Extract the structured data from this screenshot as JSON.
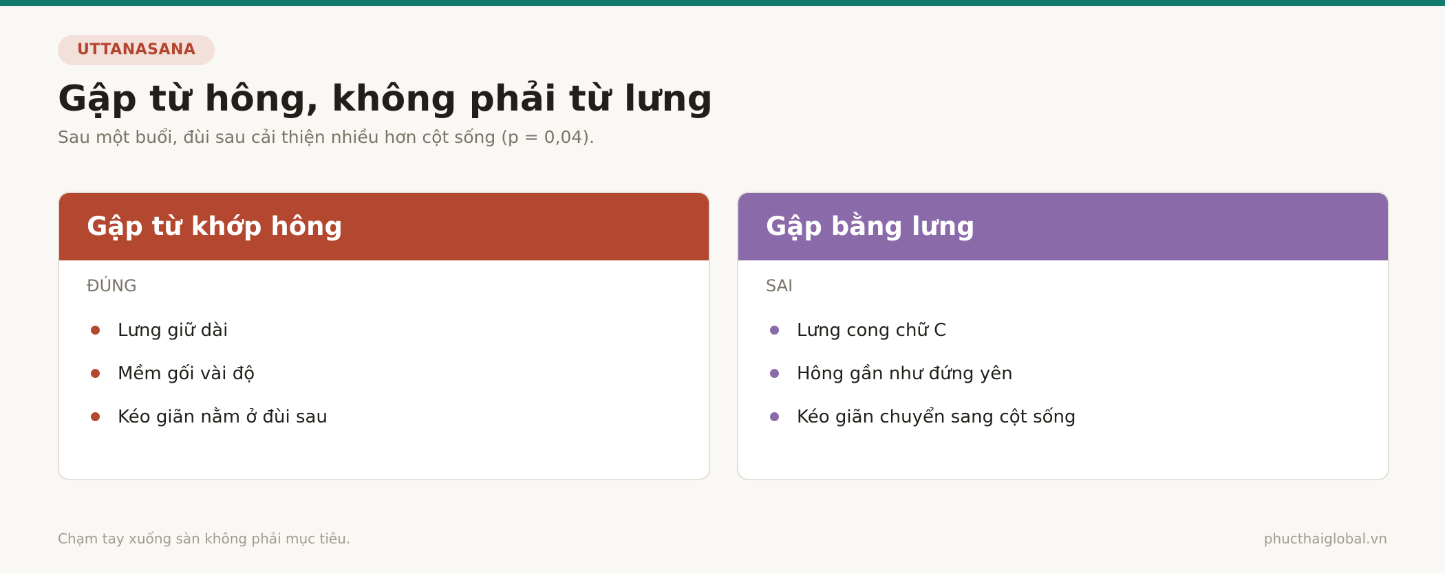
{
  "tag": "UTTANASANA",
  "title": "Gập từ hông, không phải từ lưng",
  "subtitle": "Sau một buổi, đùi sau cải thiện nhiều hơn cột sống (p = 0,04).",
  "cards": [
    {
      "header": "Gập từ khớp hông",
      "verdict": "ĐÚNG",
      "accent": "#b3472f",
      "items": [
        "Lưng giữ dài",
        "Mềm gối vài độ",
        "Kéo giãn nằm ở đùi sau"
      ]
    },
    {
      "header": "Gập bằng lưng",
      "verdict": "SAI",
      "accent": "#8b6aaa",
      "items": [
        "Lưng cong chữ C",
        "Hông gần như đứng yên",
        "Kéo giãn chuyển sang cột sống"
      ]
    }
  ],
  "footer": {
    "note": "Chạm tay xuống sàn không phải mục tiêu.",
    "site": "phucthaiglobal.vn"
  },
  "colors": {
    "top_bar": "#137a6e",
    "background": "#faf8f4"
  }
}
